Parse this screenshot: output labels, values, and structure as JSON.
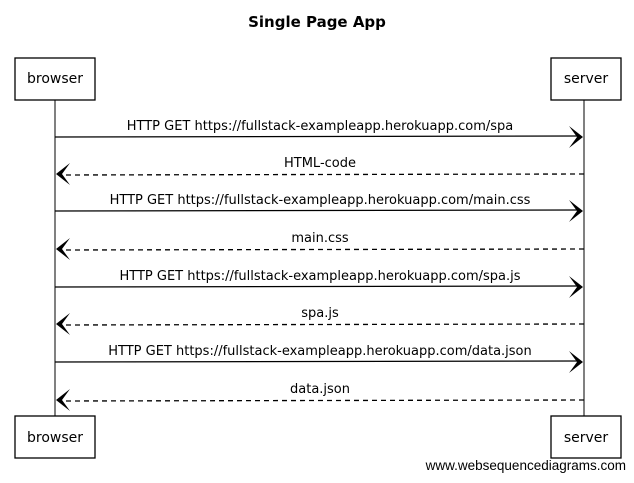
{
  "title": "Single Page App",
  "actors": [
    {
      "id": "browser",
      "label": "browser"
    },
    {
      "id": "server",
      "label": "server"
    }
  ],
  "messages": [
    {
      "from": "browser",
      "to": "server",
      "label": "HTTP GET https://fullstack-exampleapp.herokuapp.com/spa",
      "style": "solid"
    },
    {
      "from": "server",
      "to": "browser",
      "label": "HTML-code",
      "style": "dashed"
    },
    {
      "from": "browser",
      "to": "server",
      "label": "HTTP GET https://fullstack-exampleapp.herokuapp.com/main.css",
      "style": "solid"
    },
    {
      "from": "server",
      "to": "browser",
      "label": "main.css",
      "style": "dashed"
    },
    {
      "from": "browser",
      "to": "server",
      "label": "HTTP GET https://fullstack-exampleapp.herokuapp.com/spa.js",
      "style": "solid"
    },
    {
      "from": "server",
      "to": "browser",
      "label": "spa.js",
      "style": "dashed"
    },
    {
      "from": "browser",
      "to": "server",
      "label": "HTTP GET https://fullstack-exampleapp.herokuapp.com/data.json",
      "style": "solid"
    },
    {
      "from": "server",
      "to": "browser",
      "label": "data.json",
      "style": "dashed"
    }
  ],
  "credit": "www.websequencediagrams.com"
}
